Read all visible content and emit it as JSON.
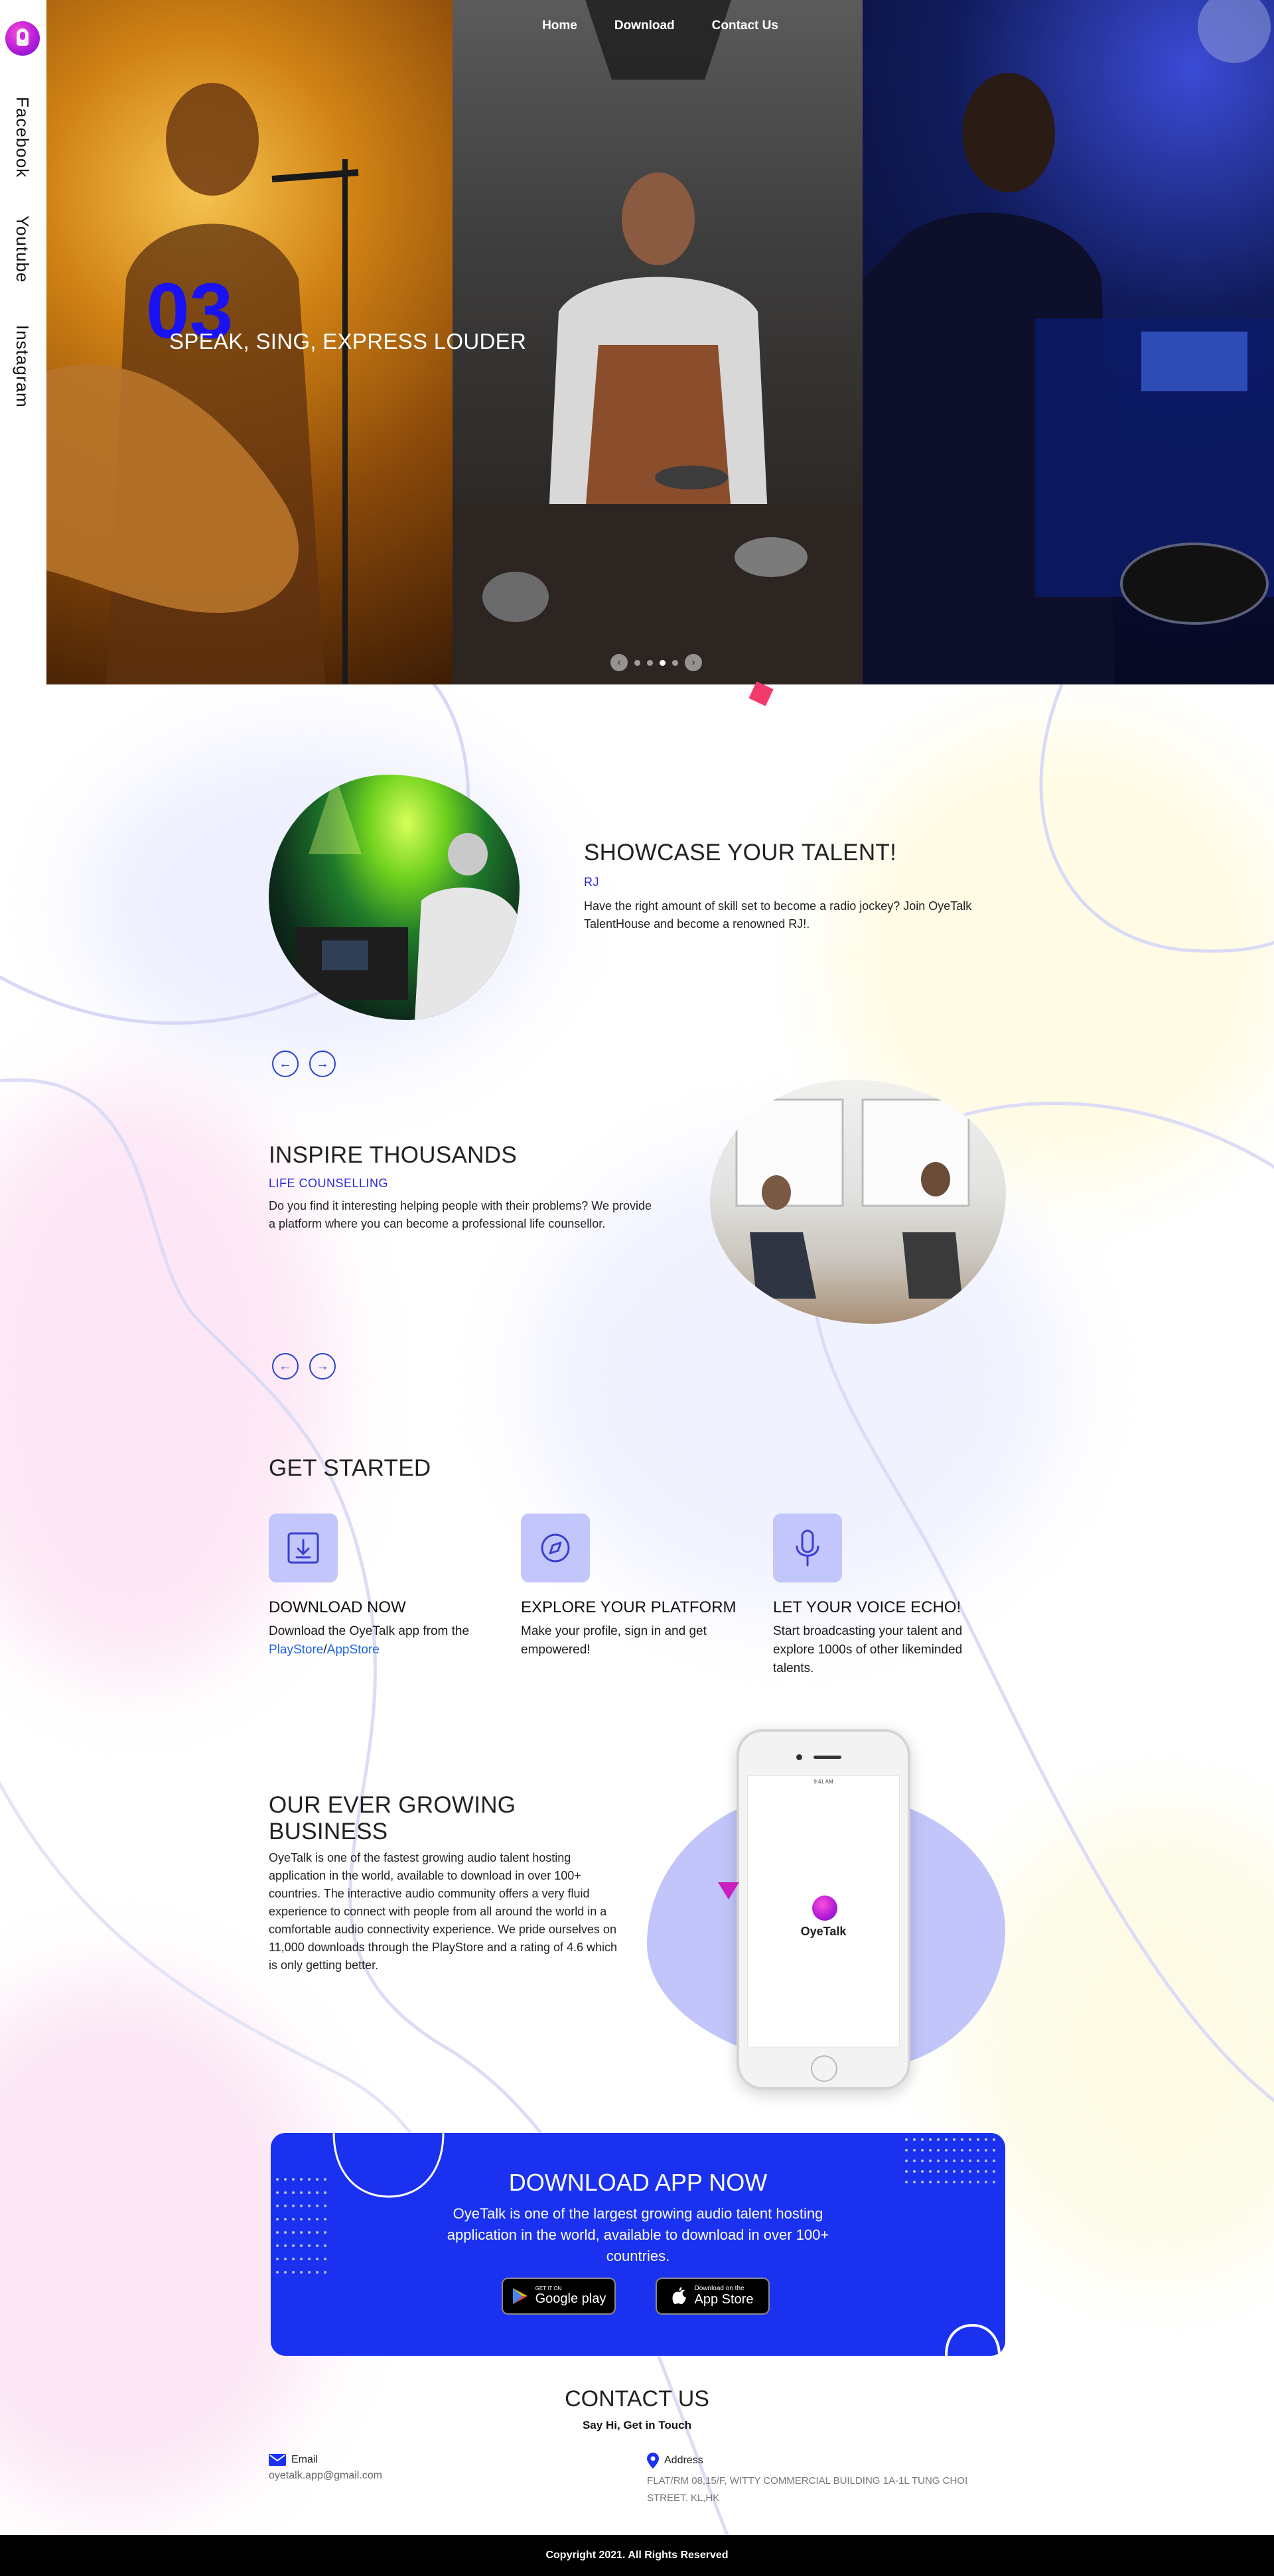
{
  "nav": {
    "home": "Home",
    "download": "Download",
    "contact": "Contact Us"
  },
  "social": {
    "facebook": "Facebook",
    "youtube": "Youtube",
    "instagram": "Instagram"
  },
  "hero": {
    "slide_number": "03",
    "tagline": "SPEAK, SING, EXPRESS LOUDER",
    "dots_total": 4,
    "dot_active": 3
  },
  "showcase": {
    "title": "SHOWCASE YOUR TALENT!",
    "label": "RJ",
    "text": "Have the right amount of skill set to become a radio jockey? Join OyeTalk TalentHouse and become a renowned RJ!."
  },
  "inspire": {
    "title": "INSPIRE THOUSANDS",
    "label": "LIFE COUNSELLING",
    "text": "Do you find it interesting helping people with their problems? We provide a platform where you can become a professional life counsellor."
  },
  "get_started": {
    "title": "GET STARTED",
    "steps": [
      {
        "title": "DOWNLOAD NOW",
        "text": "Download the OyeTalk app from the",
        "link1": "PlayStore",
        "sep": "/",
        "link2": "AppStore",
        "icon": "download-icon"
      },
      {
        "title": "EXPLORE YOUR PLATFORM",
        "text": "Make your profile, sign in and get empowered!",
        "icon": "compass-icon"
      },
      {
        "title": "LET YOUR VOICE ECHO!",
        "text": "Start broadcasting your talent and explore 1000s of other likeminded talents.",
        "icon": "microphone-icon"
      }
    ]
  },
  "business": {
    "title": "OUR EVER GROWING BUSINESS",
    "text": "OyeTalk is one of the fastest growing audio talent hosting application in the world, available to download in over 100+ countries. The interactive audio community offers a very fluid experience to connect with people from all around the world in a comfortable audio connectivity experience. We pride ourselves on 11,000 downloads through the PlayStore and a rating of 4.6 which is only getting better.",
    "app_name": "OyeTalk",
    "phone_time": "9:41 AM"
  },
  "download": {
    "title": "DOWNLOAD APP NOW",
    "text": "OyeTalk is one of the largest growing audio talent hosting application in the world, available to download in over 100+ countries.",
    "google_small": "GET IT ON",
    "google_big": "Google play",
    "apple_small": "Download on the",
    "apple_big": "App Store"
  },
  "contact": {
    "title": "CONTACT US",
    "subtitle": "Say Hi, Get in Touch",
    "email_label": "Email",
    "email_value": "oyetalk.app@gmail.com",
    "address_label": "Address",
    "address_value": "FLAT/RM 08,15/F, WITTY COMMERCIAL BUILDING 1A-1L TUNG CHOI STREET. KL,HK"
  },
  "footer": {
    "copyright": "Copyright 2021. All Rights Reserved"
  },
  "colors": {
    "accent_blue": "#1a31f0",
    "label_blue": "#2b2ad8",
    "link_blue": "#1e64e6",
    "pink": "#f23a6b",
    "lavender": "#c3c6fb"
  }
}
